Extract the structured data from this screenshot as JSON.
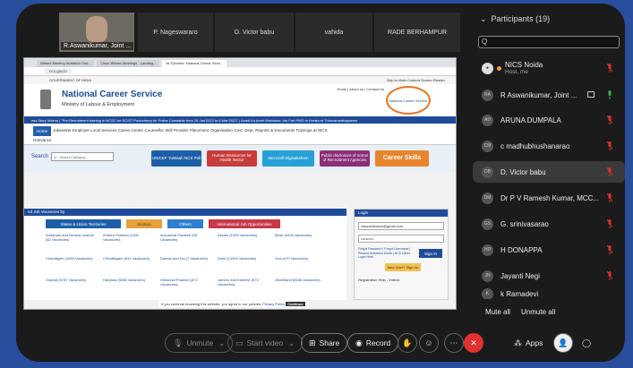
{
  "gallery": {
    "self_name": "R.Aswanikumar, Joint ...",
    "tiles": [
      "P. Nageswararo",
      "D. Victor babu",
      "vahida",
      "RADE BERHAMPUR"
    ]
  },
  "share": {
    "browser_tabs": [
      "Webex Meeting Invitation Onli...",
      "Cisco Webex Meetings - Landing...",
      "NCS|Home: National Career Servi..."
    ],
    "address": "ncs.gov.in",
    "gov_label": "GOVERNMENT OF INDIA",
    "gov_links": "Skip to Main Content   Screen Reader",
    "site_title": "National Career Service",
    "ministry": "Ministry of Labour & Employment",
    "top_links": "Home | About us | Contact Us",
    "logo_text": "National Career Service",
    "ticker": "ess Story Videos  |  \"Pre-Recruitment training in NCSC for SC/ST Puducherry for Police Constable from 29-Jan'2022 to 6-Mar'2022\"  |  Azadi Ka Amrit Mahotsav Job Fair PWD in Kerala at Thiruvananthapuram",
    "nav_home": "Home",
    "nav_items": "Jobseeker   Employer   Local Services   Career Center   Counsellor   Skill Provider   Placement Organisation   Govt. Dept.   Reports & Documents   Trainings at NICS",
    "nav_extra": "Grievance",
    "search_label": "Search",
    "search_placeholder": "Q --Select Category--",
    "pills": [
      "UNICEF YuWaah NCS Poll",
      "Human Resources for Health Sector",
      "Microsoft Digisaksham",
      "Public disclosure of norms of Recruitment Agencies",
      "Career Skills"
    ],
    "vac_header": "nd Job Vacancies by",
    "vac_tabs": [
      "States & Union Territories",
      "Sectors",
      "Others",
      "International Job Opportunities"
    ],
    "vac_cells": [
      "Andaman and Nicobar Islands (82 Vacancies)",
      "Andhra Pradesh (1932 Vacancies)",
      "Arunachal Pradesh (58 Vacancies)",
      "Assam (1059 Vacancies)",
      "Bihar (6206 Vacancies)",
      "Chandigarh (1694 Vacancies)",
      "Chhattisgarh (611 Vacancies)",
      "Daman and Diu (7 Vacancies)",
      "Delhi (14394 Vacancies)",
      "Goa (470 Vacancies)",
      "Gujarat (5787 Vacancies)",
      "Haryana (9258 Vacancies)",
      "Himachal Pradesh (872 Vacancies)",
      "Jammu and Kashmir (572 Vacancies)",
      "Jharkhand (8346 Vacancies)"
    ],
    "login_header": "Login",
    "login_email": "raswanikumar@gmail.com",
    "login_password": "••••••••••",
    "login_links": "Forgot Password | Forgot Username | Resend Activation Email | NCS Users Login Here",
    "sign_in": "Sign In",
    "new_user": "New User? Sign Up",
    "reg_help": "Registration Help - Videos",
    "cookie_text": "If you continue browsing this website, you agree to our policies:",
    "cookie_link": "Privacy Policy",
    "cookie_btn": "Continue"
  },
  "participants": {
    "title": "Participants (19)",
    "search_value": "Q",
    "list": [
      {
        "initials": "",
        "name": "NICS Noida",
        "sub": "Host, me"
      },
      {
        "initials": "RA",
        "name": "R Aswanikumar, Joint ...",
        "sub": ""
      },
      {
        "initials": "AD",
        "name": "ARUNA DUMPALA",
        "sub": ""
      },
      {
        "initials": "CM",
        "name": "c madhubhushanarao",
        "sub": ""
      },
      {
        "initials": "DB",
        "name": "D. Victor babu",
        "sub": ""
      },
      {
        "initials": "DM",
        "name": "Dr P V Ramesh Kumar, MCC...",
        "sub": ""
      },
      {
        "initials": "GS",
        "name": "G. srinivasarao",
        "sub": ""
      },
      {
        "initials": "HD",
        "name": "H DONAPPA",
        "sub": ""
      },
      {
        "initials": "JN",
        "name": "Jayanti Negi",
        "sub": ""
      },
      {
        "initials": "K",
        "name": "k Ramadevi",
        "sub": ""
      }
    ],
    "mute_all": "Mute all",
    "unmute_all": "Unmute all"
  },
  "controls": {
    "unmute": "Unmute",
    "start_video": "Start video",
    "share": "Share",
    "record": "Record",
    "apps": "Apps"
  },
  "colors": {
    "accent_blue": "#2a4e9e",
    "leave_red": "#e0312f",
    "muted_mic_red": "#e0312f"
  }
}
